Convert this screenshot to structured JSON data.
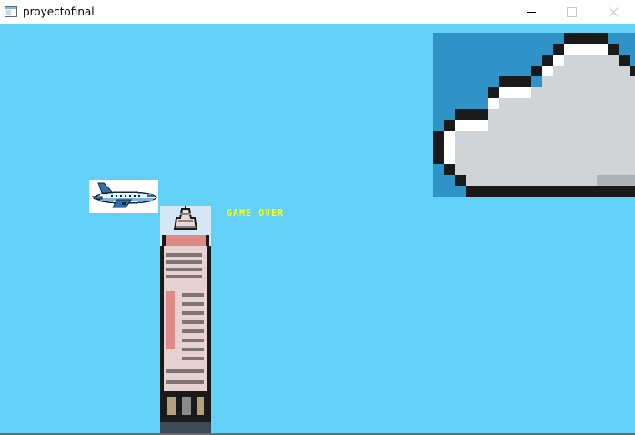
{
  "window": {
    "title": "proyectofinal",
    "controls": {
      "minimize_icon": "minimize-icon",
      "maximize_icon": "maximize-icon",
      "close_icon": "close-icon"
    }
  },
  "game": {
    "background_color": "#63d0f5",
    "status_text": "GAME OVER",
    "status_color": "#ffff00",
    "sprites": [
      "cloud",
      "airplane",
      "skyscraper"
    ]
  }
}
